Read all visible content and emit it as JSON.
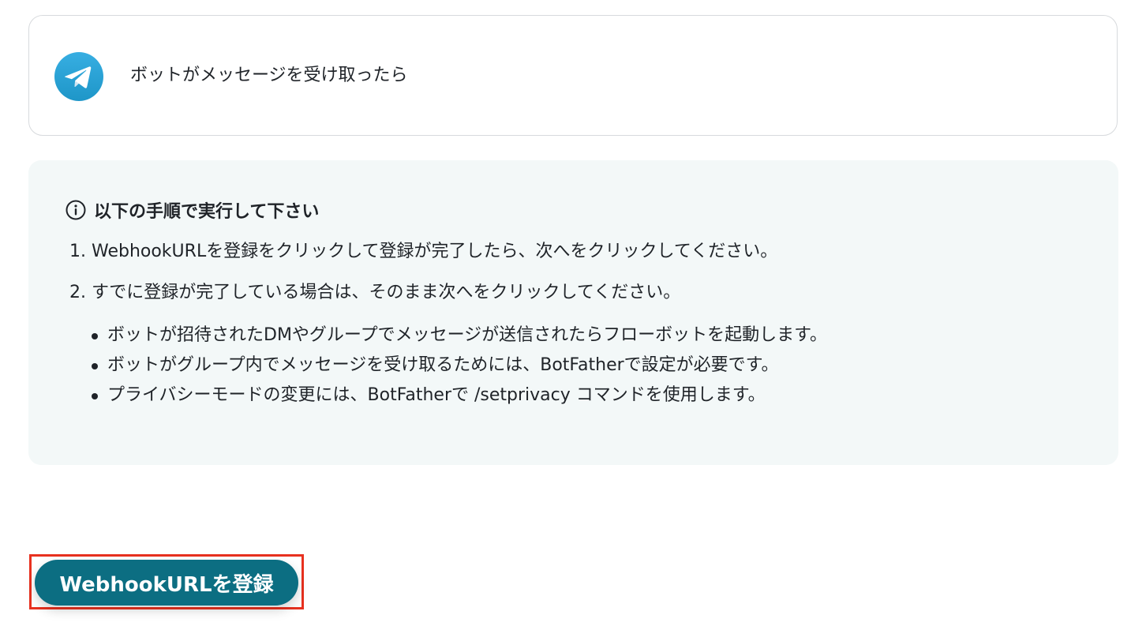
{
  "trigger": {
    "icon": "telegram-icon",
    "title": "ボットがメッセージを受け取ったら"
  },
  "info": {
    "icon": "info-icon",
    "heading": "以下の手順で実行して下さい",
    "steps": [
      "1. WebhookURLを登録をクリックして登録が完了したら、次へをクリックしてください。",
      "2. すでに登録が完了している場合は、そのまま次へをクリックしてください。"
    ],
    "notes": [
      "ボットが招待されたDMやグループでメッセージが送信されたらフローボットを起動します。",
      "ボットがグループ内でメッセージを受け取るためには、BotFatherで設定が必要です。",
      "プライバシーモードの変更には、BotFatherで /setprivacy コマンドを使用します。"
    ]
  },
  "actions": {
    "register_label": "WebhookURLを登録"
  },
  "colors": {
    "accent": "#0c6e82",
    "panel_bg": "#f3f8f8",
    "highlight_border": "#e8311f",
    "telegram_blue": "#2aa3e0"
  }
}
